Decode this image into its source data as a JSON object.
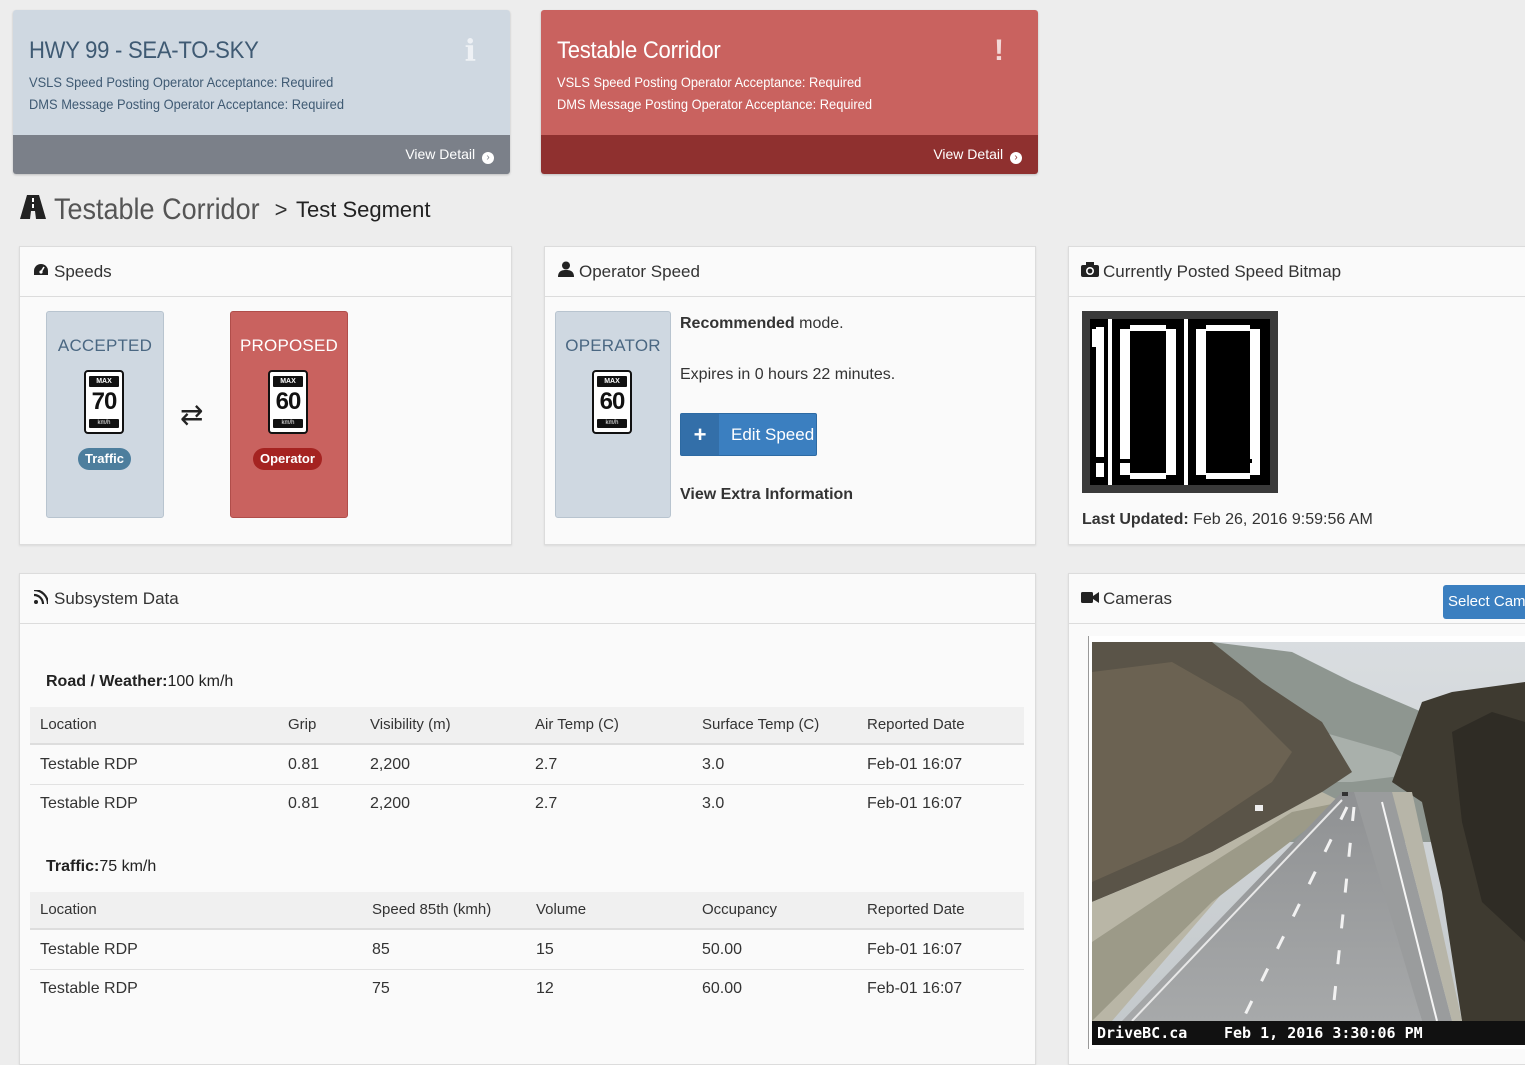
{
  "alerts": [
    {
      "title": "HWY 99 - SEA-TO-SKY",
      "line1": "VSLS Speed Posting Operator Acceptance: Required",
      "line2": "DMS Message Posting Operator Acceptance: Required",
      "footer": "View Detail",
      "icon": "info-icon",
      "icon_glyph": "i"
    },
    {
      "title": "Testable Corridor",
      "line1": "VSLS Speed Posting Operator Acceptance: Required",
      "line2": "DMS Message Posting Operator Acceptance: Required",
      "footer": "View Detail",
      "icon": "exclamation-icon",
      "icon_glyph": "!"
    }
  ],
  "breadcrumb": {
    "corridor": "Testable Corridor",
    "separator": ">",
    "segment": "Test Segment"
  },
  "speeds": {
    "title": "Speeds",
    "accepted": {
      "label": "ACCEPTED",
      "max": "MAX",
      "value": "70",
      "unit": "km/h",
      "badge": "Traffic"
    },
    "proposed": {
      "label": "PROPOSED",
      "max": "MAX",
      "value": "60",
      "unit": "km/h",
      "badge": "Operator"
    },
    "swap_glyph": "⇄"
  },
  "operator_speed": {
    "title": "Operator Speed",
    "box": {
      "label": "OPERATOR",
      "max": "MAX",
      "value": "60",
      "unit": "km/h"
    },
    "mode_bold": "Recommended",
    "mode_rest": " mode.",
    "expires": "Expires in 0 hours 22 minutes.",
    "edit_button": "Edit Speed",
    "edit_plus": "+",
    "extra_info": "View Extra Information"
  },
  "bitmap": {
    "title": "Currently Posted Speed Bitmap",
    "last_updated_label": "Last Updated:",
    "last_updated_value": " Feb 26, 2016 9:59:56 AM",
    "posted_value": "100"
  },
  "subsystem": {
    "title": "Subsystem Data",
    "road_weather": {
      "label": "Road / Weather:",
      "value": "100 km/h",
      "columns": [
        "Location",
        "Grip",
        "Visibility (m)",
        "Air Temp (C)",
        "Surface Temp (C)",
        "Reported Date"
      ],
      "rows": [
        [
          "Testable RDP",
          "0.81",
          "2,200",
          "2.7",
          "3.0",
          "Feb-01 16:07"
        ],
        [
          "Testable RDP",
          "0.81",
          "2,200",
          "2.7",
          "3.0",
          "Feb-01 16:07"
        ]
      ]
    },
    "traffic": {
      "label": "Traffic:",
      "value": "75 km/h",
      "columns": [
        "Location",
        "Speed 85th (kmh)",
        "Volume",
        "Occupancy",
        "Reported Date"
      ],
      "rows": [
        [
          "Testable RDP",
          "85",
          "15",
          "50.00",
          "Feb-01 16:07"
        ],
        [
          "Testable RDP",
          "75",
          "12",
          "60.00",
          "Feb-01 16:07"
        ]
      ]
    }
  },
  "cameras": {
    "title": "Cameras",
    "select_button": "Select Camera",
    "caption_source": "DriveBC.ca",
    "caption_time": "Feb 1, 2016 3:30:06 PM"
  },
  "colors": {
    "info_card": "#cfd8e1",
    "danger_card": "#c9625f",
    "primary_button": "#3b7fc0"
  }
}
